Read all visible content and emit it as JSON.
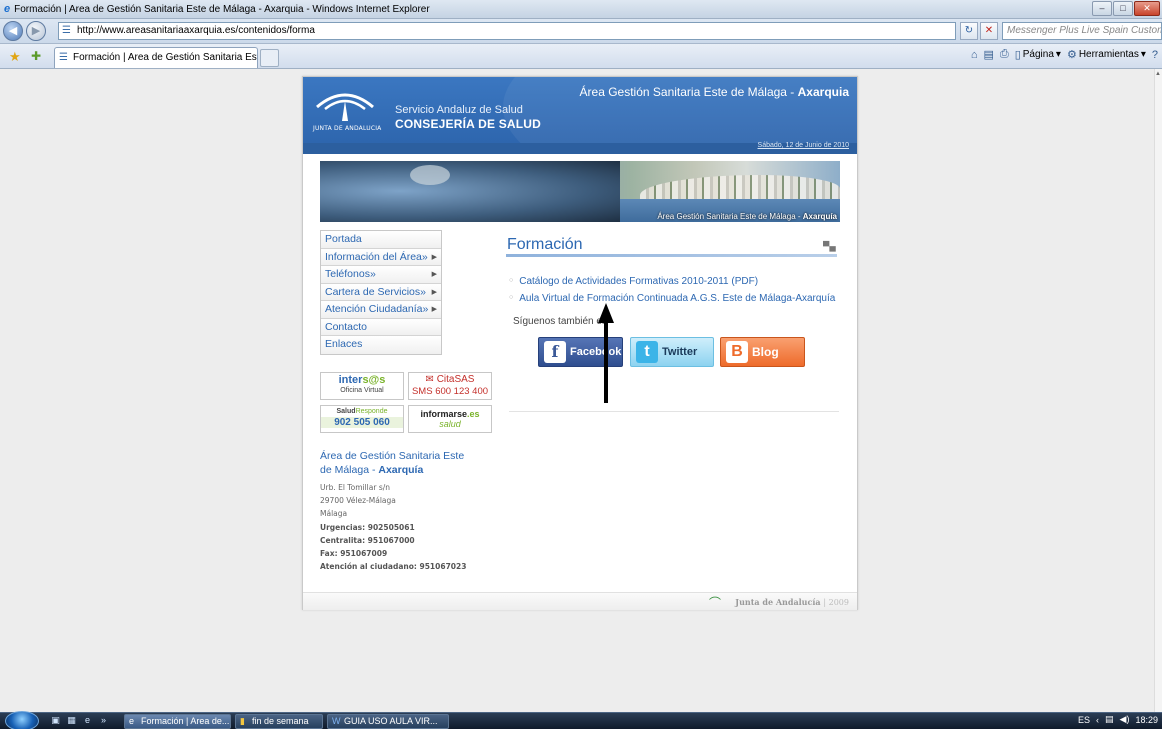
{
  "window": {
    "title": "Formación | Area de Gestión Sanitaria Este de Málaga - Axarquia - Windows Internet Explorer",
    "controls": {
      "minimize": "–",
      "maximize": "□",
      "close": "✕"
    }
  },
  "browser": {
    "back": "◀",
    "forward": "▶",
    "url": "http://www.areasanitariaaxarquia.es/contenidos/forma",
    "search_placeholder": "Messenger Plus Live Spain Customiz",
    "refresh": "↻",
    "stop": "✕",
    "tab_title": "Formación | Area de Gestión Sanitaria Este de Mál...",
    "commands": {
      "pagina": "Página",
      "herramientas": "Herramientas"
    }
  },
  "header": {
    "junta_label": "JUNTA DE ANDALUCIA",
    "sas_name": "Servicio Andaluz de Salud",
    "consejeria": "CONSEJERÍA DE SALUD",
    "area_prefix": "Área Gestión Sanitaria Este de Málaga - ",
    "area_highlight": "Axarquia",
    "date": "Sábado, 12 de Junio de 2010"
  },
  "banner": {
    "caption_prefix": "Área Gestión Sanitaria Este de Málaga - ",
    "caption_highlight": "Axarquía"
  },
  "menu": [
    {
      "label": "Portada",
      "arrow": ""
    },
    {
      "label": "Información del Área»",
      "arrow": "▶"
    },
    {
      "label": "Teléfonos»",
      "arrow": "▶"
    },
    {
      "label": "Cartera de Servicios»",
      "arrow": "▶"
    },
    {
      "label": "Atención Ciudadanía»",
      "arrow": "▶"
    },
    {
      "label": "Contacto",
      "arrow": ""
    },
    {
      "label": "Enlaces",
      "arrow": ""
    }
  ],
  "logos": {
    "intersas_a": "inter",
    "intersas_b": "s@s",
    "intersas_sub": "Oficina Virtual",
    "citasas_title": "CitaSAS",
    "citasas_sms": "SMS 600 123 400",
    "salud_a": "Salud",
    "salud_b": "Responde",
    "salud_num": "902 505 060",
    "informarse_a": "informarse",
    "informarse_b": ".es",
    "informarse_sub": "salud"
  },
  "area_info": {
    "title_a": "Área de Gestión Sanitaria Este",
    "title_b": "de Málaga - ",
    "title_highlight": "Axarquía",
    "street": "Urb. El Tomillar s/n",
    "city": "29700 Vélez-Málaga",
    "province": "Málaga",
    "urgencias": "Urgencias: 902505061",
    "centralita": "Centralita: 951067000",
    "fax": "Fax: 951067009",
    "atencion": "Atención al ciudadano: 951067023"
  },
  "content": {
    "title": "Formación",
    "links": [
      "Catálogo de Actividades Formativas 2010-2011 (PDF)",
      "Aula Virtual de Formación Continuada A.G.S. Este de Málaga-Axarquía"
    ],
    "follow_label": "Síguenos también en",
    "social": {
      "facebook": "Facebook",
      "twitter": "Twitter",
      "blog": "Blog"
    }
  },
  "footer": {
    "brand": "Junta de Andalucía",
    "year": "| 2009"
  },
  "taskbar": {
    "tasks": [
      "Formación | Area de...",
      "fin de semana",
      "GUIA USO AULA VIR..."
    ],
    "lang": "ES",
    "time": "18:29"
  },
  "colors": {
    "link_blue": "#2d68b2",
    "header_blue": "#3b77c1",
    "accent_green": "#7ab32b",
    "facebook": "#3b5998",
    "twitter": "#8dd3f0",
    "blog": "#ee6b2b"
  }
}
